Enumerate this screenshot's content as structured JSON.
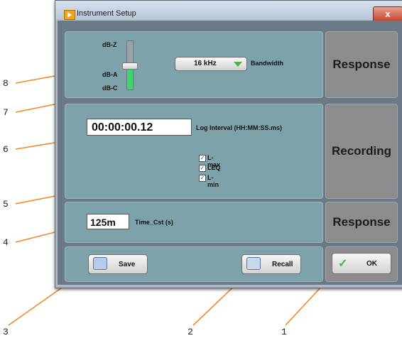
{
  "window": {
    "title": "Instrument Setup",
    "close_glyph": "x"
  },
  "weighting": {
    "top": "dB-Z",
    "middle": "dB-A",
    "bottom": "dB-C"
  },
  "bandwidth": {
    "value": "16 kHz",
    "label": "Bandwidth"
  },
  "side_buttons": {
    "response_1": "Response",
    "recording": "Recording",
    "response_2": "Response"
  },
  "log_interval": {
    "value": "00:00:00.12",
    "label": "Log Interval (HH:MM:SS.ms)"
  },
  "checkboxes": [
    {
      "label": "L-max",
      "checked": true
    },
    {
      "label": "LEQ",
      "checked": true
    },
    {
      "label": "L-min",
      "checked": true
    }
  ],
  "check_glyph": "✓",
  "time_constant": {
    "value": "125m",
    "label": "Time_Cst (s)"
  },
  "buttons": {
    "save": "Save",
    "recall": "Recall",
    "ok": "OK"
  },
  "callouts": [
    "1",
    "2",
    "3",
    "4",
    "5",
    "6",
    "7",
    "8"
  ],
  "colors": {
    "callout_line": "#f08a2a",
    "panel": "#7ea2a9",
    "side_button": "#8a8c8d",
    "slider_active": "#3cd66c"
  }
}
